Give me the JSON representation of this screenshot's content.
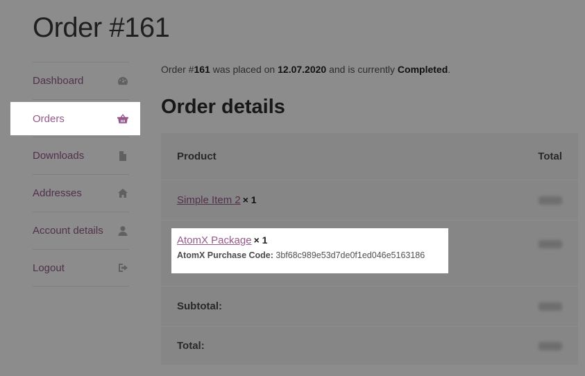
{
  "page": {
    "title": "Order #161"
  },
  "sidebar": {
    "items": [
      {
        "label": "Dashboard",
        "icon": "dashboard-icon"
      },
      {
        "label": "Orders",
        "icon": "basket-icon",
        "active": true
      },
      {
        "label": "Downloads",
        "icon": "file-icon"
      },
      {
        "label": "Addresses",
        "icon": "home-icon"
      },
      {
        "label": "Account details",
        "icon": "user-icon"
      },
      {
        "label": "Logout",
        "icon": "logout-icon"
      }
    ]
  },
  "order": {
    "summary_prefix": "Order #",
    "number": "161",
    "summary_mid": " was placed on ",
    "date": "12.07.2020",
    "summary_mid2": " and is currently ",
    "status": "Completed",
    "summary_end": "."
  },
  "details": {
    "heading": "Order details",
    "columns": {
      "product": "Product",
      "total": "Total"
    },
    "items": [
      {
        "name": "Simple Item 2",
        "qty": "× 1"
      },
      {
        "name": "AtomX Package",
        "qty": "× 1",
        "meta_label": "AtomX Purchase Code:",
        "meta_value": "3bf68c989e53d7de0f1ed046e5163186"
      }
    ],
    "subtotal_label": "Subtotal:",
    "total_label": "Total:"
  },
  "colors": {
    "accent": "#96588a",
    "table_bg": "#f5f5f5"
  }
}
